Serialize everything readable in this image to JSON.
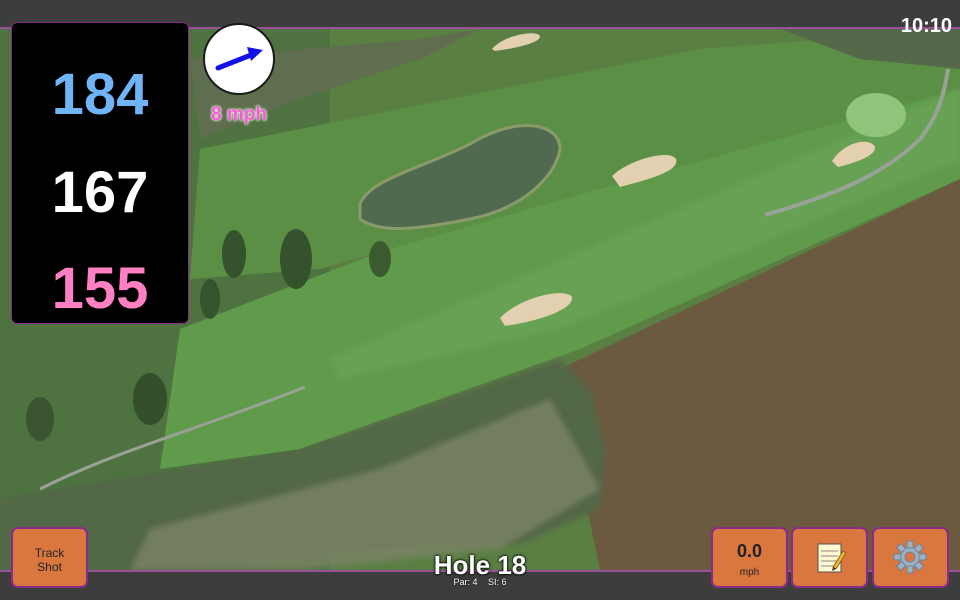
{
  "status_bar": {
    "time": "10:10"
  },
  "distances": {
    "back": "184",
    "middle": "167",
    "front": "155"
  },
  "wind": {
    "speed_text": "8 mph",
    "arrow_color": "#1411e8"
  },
  "colors": {
    "accent_border": "#8a2b8a",
    "button": "#d9773f",
    "back_distance": "#6eb4f6",
    "front_distance": "#ff7fc4",
    "wind_text": "#f25ed0"
  },
  "buttons": {
    "track_shot": {
      "line1": "Track",
      "line2": "Shot"
    },
    "speed": {
      "value": "0.0",
      "unit": "mph"
    },
    "notes_icon": "notepad-icon",
    "settings_icon": "gear-icon"
  },
  "hole": {
    "title": "Hole 18",
    "par": "Par: 4",
    "si": "SI: 6"
  }
}
